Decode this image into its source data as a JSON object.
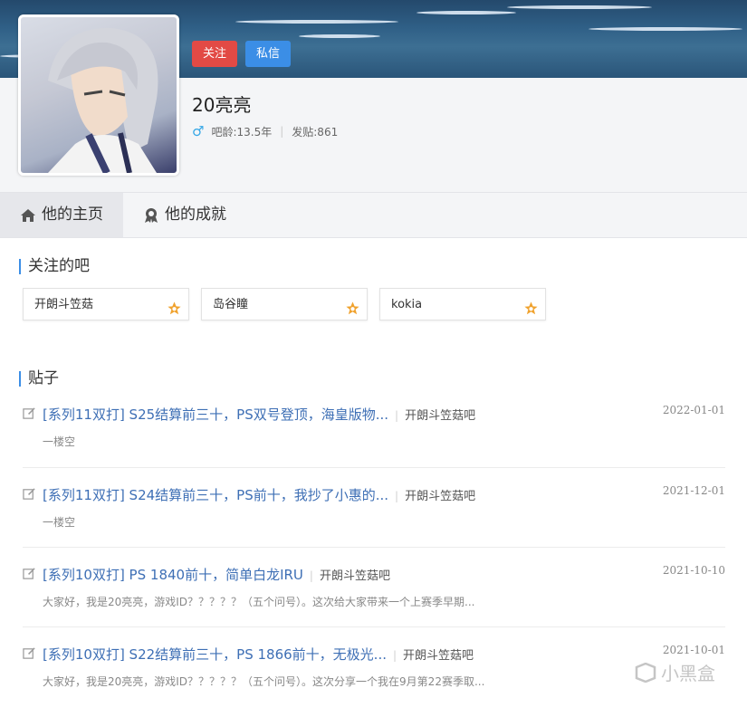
{
  "header": {
    "follow_label": "关注",
    "message_label": "私信",
    "username": "20亮亮",
    "gender_icon": "male-icon",
    "age_label": "吧龄:13.5年",
    "posts_label": "发贴:861"
  },
  "tabs": [
    {
      "label": "他的主页",
      "icon": "home-icon",
      "active": true
    },
    {
      "label": "他的成就",
      "icon": "award-icon",
      "active": false
    }
  ],
  "followed_section": {
    "title": "关注的吧",
    "bars": [
      {
        "name": "开朗斗笠菇"
      },
      {
        "name": "岛谷瞳"
      },
      {
        "name": "kokia"
      }
    ]
  },
  "posts_section": {
    "title": "贴子",
    "posts": [
      {
        "title": "[系列11双打] S25结算前三十，PS双号登顶，海皇版物...",
        "forum": "开朗斗笠菇吧",
        "date": "2022-01-01",
        "excerpt": "一楼空"
      },
      {
        "title": "[系列11双打] S24结算前三十，PS前十，我抄了小惠的...",
        "forum": "开朗斗笠菇吧",
        "date": "2021-12-01",
        "excerpt": "一楼空"
      },
      {
        "title": "[系列10双打] PS 1840前十，简单白龙IRU",
        "forum": "开朗斗笠菇吧",
        "date": "2021-10-10",
        "excerpt": "大家好，我是20亮亮，游戏ID？？？？？（五个问号）。这次给大家带来一个上赛季早期..."
      },
      {
        "title": "[系列10双打] S22结算前三十，PS 1866前十，无极光...",
        "forum": "开朗斗笠菇吧",
        "date": "2021-10-01",
        "excerpt": "大家好，我是20亮亮，游戏ID？？？？？（五个问号）。这次分享一个我在9月第22赛季取..."
      }
    ]
  },
  "watermark": "小黑盒",
  "colors": {
    "accent": "#3b8ee6",
    "follow": "#e24a45",
    "link": "#3e6fb5",
    "star": "#f0a22e"
  }
}
